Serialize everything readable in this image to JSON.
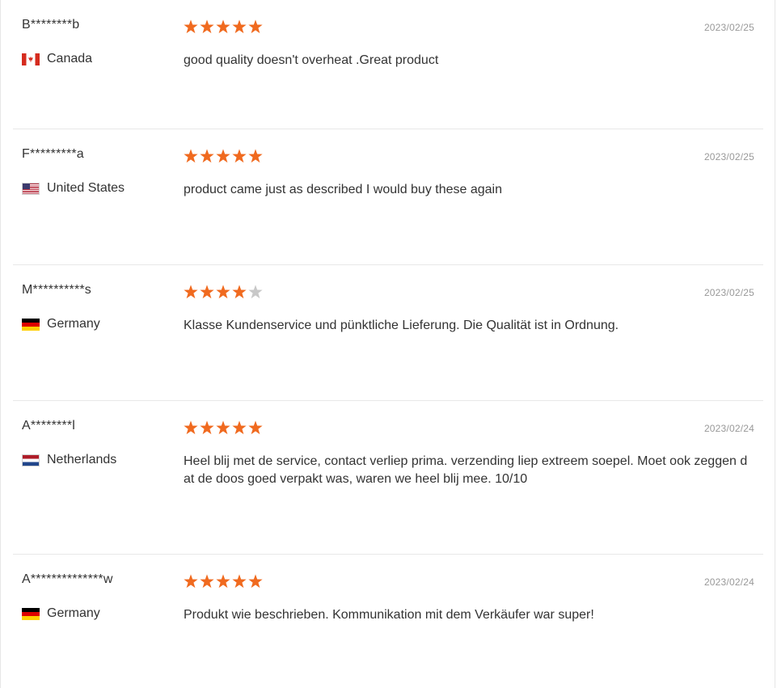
{
  "reviews": [
    {
      "name": "B********b",
      "country": "Canada",
      "flag_icon": "canada-flag-icon",
      "rating": 5,
      "date": "2023/02/25",
      "comment": "good quality doesn't overheat .Great product"
    },
    {
      "name": "F*********a",
      "country": "United States",
      "flag_icon": "united-states-flag-icon",
      "rating": 5,
      "date": "2023/02/25",
      "comment": "product came just as described I would buy these again"
    },
    {
      "name": "M**********s",
      "country": "Germany",
      "flag_icon": "germany-flag-icon",
      "rating": 4,
      "date": "2023/02/25",
      "comment": "Klasse Kundenservice und pünktliche Lieferung. Die Qualität ist in Ordnung."
    },
    {
      "name": "A********l",
      "country": "Netherlands",
      "flag_icon": "netherlands-flag-icon",
      "rating": 5,
      "date": "2023/02/24",
      "comment": "Heel blij met de service, contact verliep prima. verzending liep extreem soepel. Moet ook zeggen dat de doos goed verpakt was, waren we heel blij mee. 10/10"
    },
    {
      "name": "A**************w",
      "country": "Germany",
      "flag_icon": "germany-flag-icon",
      "rating": 5,
      "date": "2023/02/24",
      "comment": "Produkt wie beschrieben. Kommunikation mit dem Verkäufer war super!"
    }
  ],
  "rating_max": 5,
  "colors": {
    "star_filled": "#f06a1f",
    "star_empty": "#c8c8c8",
    "date_text": "#999999",
    "divider": "#e8e8e8"
  }
}
